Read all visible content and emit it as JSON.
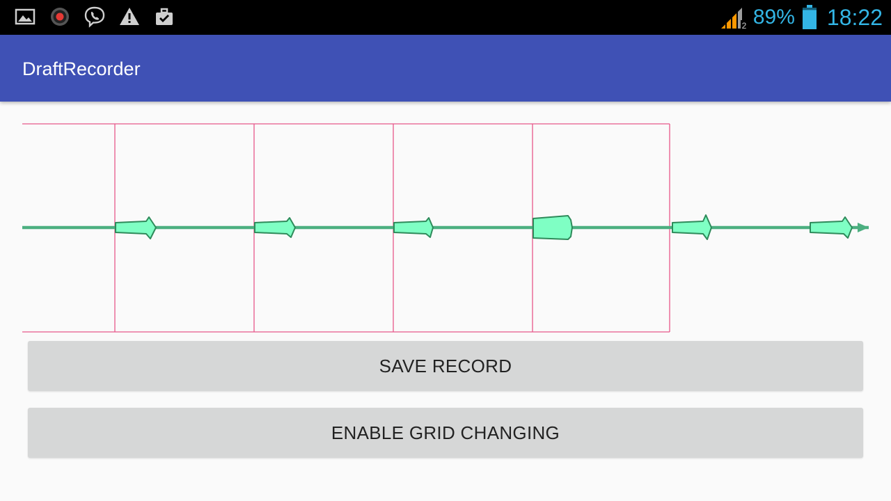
{
  "status_bar": {
    "left_icons": [
      "gallery-icon",
      "record-icon",
      "viber-icon",
      "warning-icon",
      "briefcase-check-icon"
    ],
    "signal_icon": "signal-bars-icon",
    "signal_sim": "2",
    "battery_percent": "89%",
    "battery_level": 0.89,
    "time": "18:22",
    "text_color": "#33b5e5"
  },
  "app_bar": {
    "title": "DraftRecorder",
    "color": "#3f51b5"
  },
  "recorder": {
    "grid_color": "#e8578a",
    "line_color": "#4caf80",
    "marker_fill": "#7fffc4",
    "marker_stroke": "#2e8a5a",
    "grid_cells": 5,
    "marker_count": 7
  },
  "buttons": {
    "save_label": "SAVE RECORD",
    "grid_label": "ENABLE GRID CHANGING"
  }
}
